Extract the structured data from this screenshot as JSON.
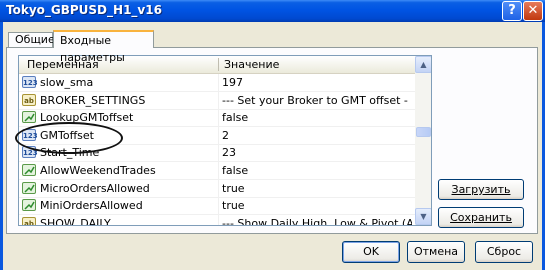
{
  "window": {
    "title": "Tokyo_GBPUSD_H1_v16",
    "help": "?",
    "close": "✕"
  },
  "tabs": [
    {
      "label": "Общие"
    },
    {
      "label": "Входные параметры"
    }
  ],
  "table": {
    "headers": {
      "name": "Переменная",
      "value": "Значение"
    },
    "rows": [
      {
        "name": "slow_sma",
        "value": "197",
        "type": "int",
        "icon_text": "123"
      },
      {
        "name": "BROKER_SETTINGS",
        "value": "--- Set your Broker to GMT offset - Default ...",
        "type": "string",
        "icon_text": "ab"
      },
      {
        "name": "LookupGMToffset",
        "value": "false",
        "type": "bool",
        "icon_text": ""
      },
      {
        "name": "GMToffset",
        "value": "2",
        "type": "int",
        "icon_text": "123"
      },
      {
        "name": "Start_Time",
        "value": "23",
        "type": "int",
        "icon_text": "123"
      },
      {
        "name": "AllowWeekendTrades",
        "value": "false",
        "type": "bool",
        "icon_text": ""
      },
      {
        "name": "MicroOrdersAllowed",
        "value": "true",
        "type": "bool",
        "icon_text": ""
      },
      {
        "name": "MiniOrdersAllowed",
        "value": "true",
        "type": "bool",
        "icon_text": ""
      },
      {
        "name": "SHOW_DAILY",
        "value": "--- Show Daily High, Low & Pivot (Auto Dis...",
        "type": "string",
        "icon_text": "ab"
      }
    ]
  },
  "scroll": {
    "up": "▲",
    "down": "▼"
  },
  "buttons": {
    "load": "Загрузить",
    "save": "Сохранить",
    "ok": "OK",
    "cancel": "Отмена",
    "reset": "Сброс"
  }
}
